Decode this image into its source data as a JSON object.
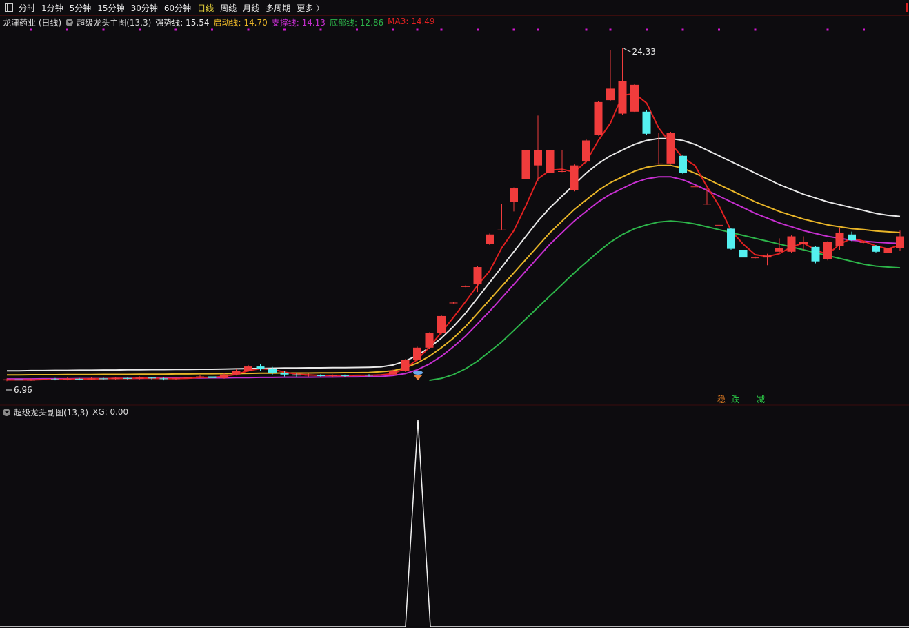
{
  "toolbar": {
    "tabs": [
      "分时",
      "1分钟",
      "5分钟",
      "15分钟",
      "30分钟",
      "60分钟",
      "日线",
      "周线",
      "月线",
      "多周期",
      "更多 〉"
    ],
    "active": "日线"
  },
  "main": {
    "stock": "龙津药业 (日线)",
    "indicator": "超级龙头主图(13,3)",
    "legend": [
      {
        "label": "强势线: 15.54",
        "color": "#e8e8e8"
      },
      {
        "label": "启动线: 14.70",
        "color": "#e8b528"
      },
      {
        "label": "支撑线: 14.13",
        "color": "#c62fd0"
      },
      {
        "label": "底部线: 12.86",
        "color": "#2db54a"
      },
      {
        "label": "MA3: 14.49",
        "color": "#e02020"
      }
    ],
    "high_label": "24.33",
    "low_label": "6.96",
    "markers": [
      {
        "text": "稳",
        "color": "#e07b22"
      },
      {
        "text": "跌",
        "color": "#2dd64a"
      },
      {
        "text": "减",
        "color": "#2dd64a"
      }
    ]
  },
  "sub": {
    "indicator": "超级龙头副图(13,3)",
    "value": "XG: 0.00"
  },
  "colors": {
    "up": "#f03c3c",
    "down": "#54f0f0",
    "strong": "#e8e8e8",
    "start": "#e8b528",
    "support": "#c62fd0",
    "bottom": "#2db54a",
    "ma3": "#e02020",
    "dots": "#d218d2"
  },
  "chart_data": [
    {
      "type": "candlestick",
      "ylim": [
        6.5,
        25.2
      ],
      "candles": [
        {
          "o": 7.0,
          "c": 7.05,
          "h": 7.1,
          "l": 6.96
        },
        {
          "o": 7.05,
          "c": 7.0,
          "h": 7.1,
          "l": 6.96
        },
        {
          "o": 7.0,
          "c": 7.02,
          "h": 7.1,
          "l": 6.97
        },
        {
          "o": 7.02,
          "c": 7.06,
          "h": 7.12,
          "l": 6.98
        },
        {
          "o": 7.06,
          "c": 7.04,
          "h": 7.12,
          "l": 7.0
        },
        {
          "o": 7.04,
          "c": 7.08,
          "h": 7.14,
          "l": 7.0
        },
        {
          "o": 7.08,
          "c": 7.05,
          "h": 7.12,
          "l": 7.0
        },
        {
          "o": 7.05,
          "c": 7.1,
          "h": 7.16,
          "l": 7.02
        },
        {
          "o": 7.1,
          "c": 7.06,
          "h": 7.14,
          "l": 7.02
        },
        {
          "o": 7.06,
          "c": 7.12,
          "h": 7.18,
          "l": 7.03
        },
        {
          "o": 7.12,
          "c": 7.08,
          "h": 7.16,
          "l": 7.04
        },
        {
          "o": 7.08,
          "c": 7.14,
          "h": 7.2,
          "l": 7.05
        },
        {
          "o": 7.14,
          "c": 7.1,
          "h": 7.18,
          "l": 7.05
        },
        {
          "o": 7.1,
          "c": 7.06,
          "h": 7.14,
          "l": 7.0
        },
        {
          "o": 7.06,
          "c": 7.1,
          "h": 7.15,
          "l": 7.02
        },
        {
          "o": 7.1,
          "c": 7.14,
          "h": 7.2,
          "l": 7.05
        },
        {
          "o": 7.14,
          "c": 7.2,
          "h": 7.26,
          "l": 7.1
        },
        {
          "o": 7.2,
          "c": 7.12,
          "h": 7.24,
          "l": 7.06
        },
        {
          "o": 7.12,
          "c": 7.3,
          "h": 7.36,
          "l": 7.08
        },
        {
          "o": 7.3,
          "c": 7.5,
          "h": 7.6,
          "l": 7.25
        },
        {
          "o": 7.5,
          "c": 7.72,
          "h": 7.8,
          "l": 7.45
        },
        {
          "o": 7.72,
          "c": 7.6,
          "h": 7.85,
          "l": 7.5
        },
        {
          "o": 7.6,
          "c": 7.4,
          "h": 7.7,
          "l": 7.3
        },
        {
          "o": 7.4,
          "c": 7.3,
          "h": 7.5,
          "l": 7.2
        },
        {
          "o": 7.3,
          "c": 7.25,
          "h": 7.36,
          "l": 7.18
        },
        {
          "o": 7.25,
          "c": 7.28,
          "h": 7.34,
          "l": 7.2
        },
        {
          "o": 7.28,
          "c": 7.22,
          "h": 7.32,
          "l": 7.16
        },
        {
          "o": 7.22,
          "c": 7.26,
          "h": 7.3,
          "l": 7.18
        },
        {
          "o": 7.26,
          "c": 7.24,
          "h": 7.3,
          "l": 7.18
        },
        {
          "o": 7.24,
          "c": 7.28,
          "h": 7.34,
          "l": 7.2
        },
        {
          "o": 7.28,
          "c": 7.26,
          "h": 7.32,
          "l": 7.2
        },
        {
          "o": 7.26,
          "c": 7.3,
          "h": 7.36,
          "l": 7.22
        },
        {
          "o": 7.3,
          "c": 7.5,
          "h": 7.56,
          "l": 7.26
        },
        {
          "o": 7.5,
          "c": 8.05,
          "h": 8.1,
          "l": 7.45
        },
        {
          "o": 8.05,
          "c": 8.7,
          "h": 8.75,
          "l": 8.0
        },
        {
          "o": 8.7,
          "c": 9.45,
          "h": 9.5,
          "l": 8.65
        },
        {
          "o": 9.45,
          "c": 10.35,
          "h": 10.4,
          "l": 9.4
        },
        {
          "o": 11.05,
          "c": 11.05,
          "h": 11.1,
          "l": 11.0
        },
        {
          "o": 11.9,
          "c": 11.9,
          "h": 11.95,
          "l": 11.85
        },
        {
          "o": 12.0,
          "c": 12.9,
          "h": 12.95,
          "l": 11.6
        },
        {
          "o": 14.1,
          "c": 14.6,
          "h": 14.65,
          "l": 14.05
        },
        {
          "o": 14.85,
          "c": 14.85,
          "h": 16.2,
          "l": 14.85
        },
        {
          "o": 16.3,
          "c": 17.0,
          "h": 17.05,
          "l": 15.8
        },
        {
          "o": 17.5,
          "c": 19.0,
          "h": 19.05,
          "l": 17.4
        },
        {
          "o": 18.2,
          "c": 19.0,
          "h": 20.8,
          "l": 17.4
        },
        {
          "o": 17.8,
          "c": 19.0,
          "h": 19.05,
          "l": 17.75
        },
        {
          "o": 17.9,
          "c": 17.9,
          "h": 19.0,
          "l": 17.85
        },
        {
          "o": 16.9,
          "c": 18.2,
          "h": 18.25,
          "l": 16.85
        },
        {
          "o": 18.4,
          "c": 19.5,
          "h": 19.55,
          "l": 18.35
        },
        {
          "o": 19.8,
          "c": 21.5,
          "h": 21.55,
          "l": 19.75
        },
        {
          "o": 21.6,
          "c": 22.2,
          "h": 24.2,
          "l": 21.55
        },
        {
          "o": 20.9,
          "c": 22.6,
          "h": 24.33,
          "l": 20.85
        },
        {
          "o": 21.0,
          "c": 22.4,
          "h": 22.45,
          "l": 20.95
        },
        {
          "o": 21.0,
          "c": 19.85,
          "h": 21.1,
          "l": 19.8
        },
        {
          "o": 18.3,
          "c": 18.3,
          "h": 19.9,
          "l": 18.25
        },
        {
          "o": 18.3,
          "c": 19.9,
          "h": 19.95,
          "l": 18.25
        },
        {
          "o": 18.7,
          "c": 17.8,
          "h": 18.75,
          "l": 17.75
        },
        {
          "o": 17.1,
          "c": 17.1,
          "h": 17.8,
          "l": 17.05
        },
        {
          "o": 16.2,
          "c": 16.2,
          "h": 17.0,
          "l": 16.15
        },
        {
          "o": 15.1,
          "c": 15.1,
          "h": 16.2,
          "l": 15.05
        },
        {
          "o": 14.9,
          "c": 13.85,
          "h": 14.95,
          "l": 13.8
        },
        {
          "o": 13.8,
          "c": 13.4,
          "h": 13.85,
          "l": 13.1
        },
        {
          "o": 13.4,
          "c": 13.4,
          "h": 13.45,
          "l": 13.35
        },
        {
          "o": 13.4,
          "c": 13.5,
          "h": 13.6,
          "l": 13.0
        },
        {
          "o": 13.7,
          "c": 13.9,
          "h": 14.4,
          "l": 13.65
        },
        {
          "o": 13.7,
          "c": 14.5,
          "h": 14.55,
          "l": 13.65
        },
        {
          "o": 14.1,
          "c": 14.2,
          "h": 14.5,
          "l": 13.8
        },
        {
          "o": 13.95,
          "c": 13.2,
          "h": 14.0,
          "l": 13.1
        },
        {
          "o": 13.3,
          "c": 14.2,
          "h": 14.25,
          "l": 13.25
        },
        {
          "o": 14.0,
          "c": 14.7,
          "h": 14.95,
          "l": 13.8
        },
        {
          "o": 14.6,
          "c": 14.3,
          "h": 14.75,
          "l": 14.25
        },
        {
          "o": 14.2,
          "c": 14.2,
          "h": 14.25,
          "l": 14.15
        },
        {
          "o": 14.0,
          "c": 13.7,
          "h": 14.05,
          "l": 13.65
        },
        {
          "o": 13.65,
          "c": 13.9,
          "h": 13.95,
          "l": 13.6
        },
        {
          "o": 13.9,
          "c": 14.5,
          "h": 14.8,
          "l": 13.75
        }
      ],
      "ma3": [
        7.02,
        7.02,
        7.02,
        7.04,
        7.04,
        7.06,
        7.06,
        7.08,
        7.08,
        7.1,
        7.09,
        7.11,
        7.1,
        7.09,
        7.09,
        7.1,
        7.15,
        7.15,
        7.21,
        7.31,
        7.5,
        7.61,
        7.57,
        7.43,
        7.32,
        7.28,
        7.25,
        7.25,
        7.24,
        7.26,
        7.26,
        7.28,
        7.35,
        7.62,
        8.08,
        8.73,
        9.5,
        10.28,
        11.1,
        11.95,
        12.7,
        13.9,
        14.8,
        16.1,
        17.5,
        17.95,
        18.0,
        17.85,
        18.4,
        19.5,
        20.4,
        21.85,
        21.95,
        21.45,
        20.15,
        19.35,
        18.6,
        18.2,
        17.1,
        16.1,
        14.8,
        14.1,
        13.55,
        13.45,
        13.6,
        13.95,
        14.15,
        13.8,
        13.55,
        14.1,
        14.4,
        14.25,
        14.0,
        13.85,
        14.05
      ],
      "strong": [
        7.5,
        7.5,
        7.51,
        7.51,
        7.52,
        7.52,
        7.53,
        7.53,
        7.54,
        7.54,
        7.55,
        7.55,
        7.56,
        7.56,
        7.57,
        7.57,
        7.58,
        7.58,
        7.59,
        7.6,
        7.61,
        7.62,
        7.63,
        7.64,
        7.64,
        7.65,
        7.65,
        7.66,
        7.66,
        7.67,
        7.68,
        7.7,
        7.8,
        8.0,
        8.3,
        8.7,
        9.2,
        9.8,
        10.5,
        11.3,
        12.1,
        12.9,
        13.7,
        14.5,
        15.3,
        16.0,
        16.6,
        17.2,
        17.8,
        18.3,
        18.7,
        19.0,
        19.3,
        19.5,
        19.6,
        19.6,
        19.5,
        19.3,
        19.0,
        18.7,
        18.4,
        18.1,
        17.8,
        17.5,
        17.2,
        16.95,
        16.7,
        16.5,
        16.3,
        16.15,
        16.0,
        15.85,
        15.7,
        15.6,
        15.54
      ],
      "start": [
        7.28,
        7.28,
        7.29,
        7.29,
        7.29,
        7.3,
        7.3,
        7.3,
        7.31,
        7.31,
        7.31,
        7.32,
        7.32,
        7.32,
        7.33,
        7.33,
        7.34,
        7.34,
        7.35,
        7.35,
        7.36,
        7.37,
        7.37,
        7.38,
        7.38,
        7.38,
        7.39,
        7.39,
        7.4,
        7.4,
        7.41,
        7.45,
        7.5,
        7.65,
        7.9,
        8.25,
        8.7,
        9.2,
        9.8,
        10.5,
        11.2,
        11.9,
        12.6,
        13.3,
        14.0,
        14.7,
        15.3,
        15.9,
        16.4,
        16.9,
        17.3,
        17.6,
        17.9,
        18.1,
        18.2,
        18.2,
        18.05,
        17.8,
        17.5,
        17.2,
        16.9,
        16.6,
        16.3,
        16.05,
        15.8,
        15.6,
        15.4,
        15.25,
        15.1,
        15.0,
        14.9,
        14.85,
        14.78,
        14.74,
        14.7
      ],
      "support": [
        7.07,
        7.07,
        7.07,
        7.08,
        7.08,
        7.08,
        7.09,
        7.09,
        7.09,
        7.1,
        7.1,
        7.1,
        7.11,
        7.11,
        7.11,
        7.12,
        7.12,
        7.13,
        7.13,
        7.14,
        7.14,
        7.15,
        7.15,
        7.16,
        7.16,
        7.16,
        7.17,
        7.17,
        7.18,
        7.18,
        7.19,
        7.2,
        7.25,
        7.35,
        7.55,
        7.85,
        8.25,
        8.75,
        9.3,
        9.95,
        10.6,
        11.3,
        12.0,
        12.7,
        13.4,
        14.1,
        14.7,
        15.3,
        15.8,
        16.3,
        16.7,
        17.0,
        17.3,
        17.5,
        17.6,
        17.6,
        17.45,
        17.2,
        16.9,
        16.6,
        16.3,
        16.0,
        15.7,
        15.45,
        15.2,
        15.0,
        14.8,
        14.65,
        14.5,
        14.4,
        14.3,
        14.25,
        14.2,
        14.16,
        14.13
      ],
      "bottom_start_index": 35,
      "bottom": [
        7.0,
        7.1,
        7.3,
        7.6,
        8.0,
        8.5,
        9.0,
        9.6,
        10.2,
        10.8,
        11.4,
        12.0,
        12.6,
        13.15,
        13.7,
        14.2,
        14.6,
        14.9,
        15.1,
        15.25,
        15.3,
        15.25,
        15.15,
        15.0,
        14.85,
        14.7,
        14.55,
        14.4,
        14.25,
        14.1,
        13.95,
        13.8,
        13.65,
        13.5,
        13.35,
        13.2,
        13.05,
        12.95,
        12.9,
        12.86
      ],
      "dot_indices": [
        2,
        5,
        8,
        11,
        14,
        17,
        20,
        23,
        26,
        29,
        32,
        34,
        36,
        39,
        42,
        44,
        48,
        50,
        53,
        56,
        59,
        62,
        68,
        71
      ]
    },
    {
      "type": "line",
      "series": [
        {
          "name": "XG",
          "peak_index": 34,
          "peak_value": 1,
          "base": 0
        }
      ],
      "ylim": [
        0,
        1
      ]
    }
  ]
}
